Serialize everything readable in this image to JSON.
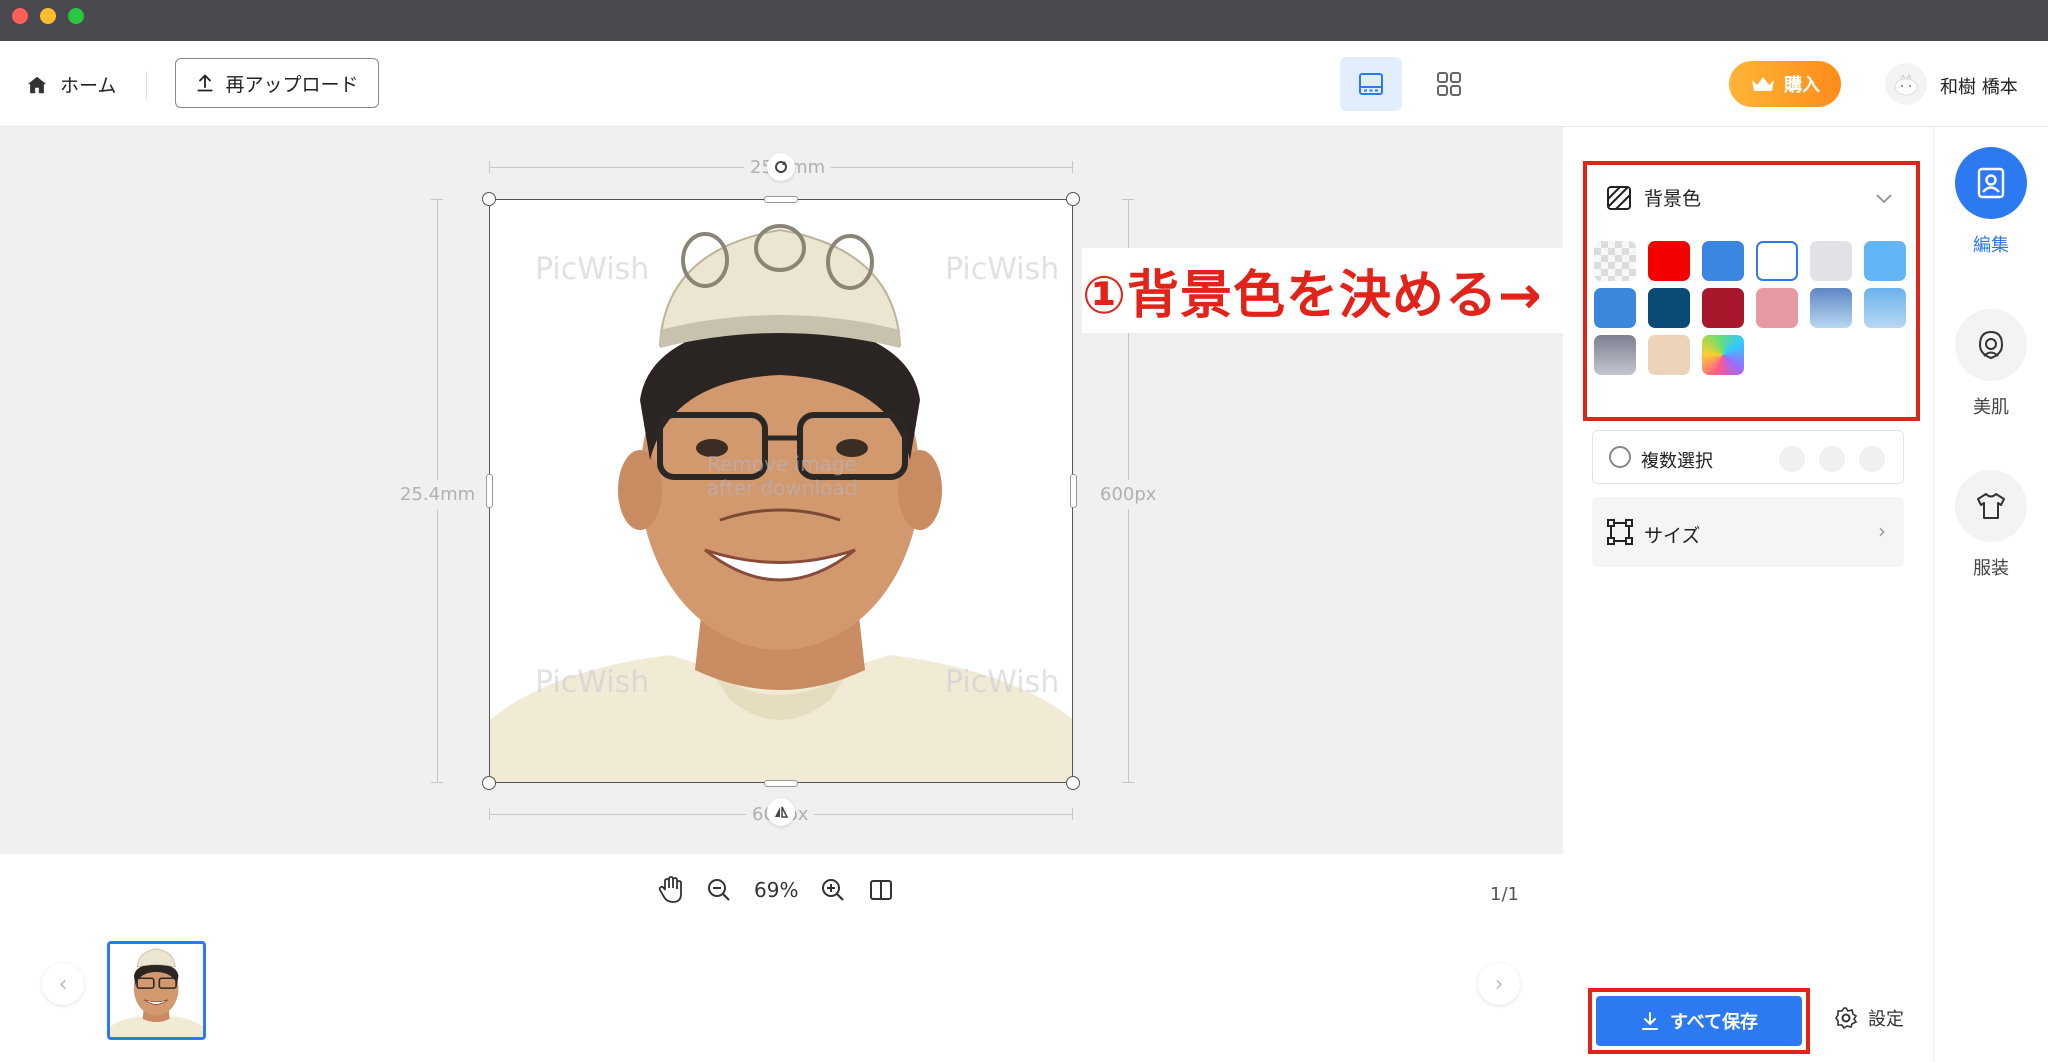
{
  "header": {
    "home_label": "ホーム",
    "reupload_label": "再アップロード",
    "buy_label": "購入",
    "username": "和樹 橋本"
  },
  "canvas": {
    "width_mm": "25.4mm",
    "height_mm": "25.4mm",
    "height_px": "600px",
    "width_px": "600px",
    "watermark": "PicWish",
    "center_watermark_1": "Remove image",
    "center_watermark_2": "after download"
  },
  "annotation": {
    "text": "①背景色を決める→"
  },
  "zoom": {
    "value": "69%"
  },
  "pager": "1/1",
  "panel": {
    "background_title": "背景色",
    "swatches": [
      {
        "name": "transparent",
        "color": "checker"
      },
      {
        "name": "red",
        "color": "#f50000"
      },
      {
        "name": "blue",
        "color": "#3a86e0"
      },
      {
        "name": "white",
        "color": "#ffffff"
      },
      {
        "name": "light-gray",
        "color": "#e2e1e6"
      },
      {
        "name": "sky-blue",
        "color": "#64b5f6"
      },
      {
        "name": "medium-blue",
        "color": "#3b87dd"
      },
      {
        "name": "navy",
        "color": "#0a4b75"
      },
      {
        "name": "dark-red",
        "color": "#a8172b"
      },
      {
        "name": "pink",
        "color": "#e89aa3"
      },
      {
        "name": "gradient-blue",
        "color": "#5d86c2"
      },
      {
        "name": "gradient-sky",
        "color": "#6ab3ee"
      },
      {
        "name": "gradient-gray",
        "color": "#8f93a0"
      },
      {
        "name": "beige",
        "color": "#ecd3b9"
      },
      {
        "name": "rainbow",
        "color": "rainbow"
      }
    ],
    "multi_select_label": "複数選択",
    "size_label": "サイズ",
    "save_all_label": "すべて保存",
    "settings_label": "設定"
  },
  "sidebar": {
    "items": [
      {
        "label": "編集",
        "icon": "portrait-icon",
        "active": true
      },
      {
        "label": "美肌",
        "icon": "face-icon",
        "active": false
      },
      {
        "label": "服装",
        "icon": "shirt-icon",
        "active": false
      }
    ]
  },
  "colors": {
    "accent": "#2d79f2",
    "annotation_red": "#e2231a",
    "buy_orange": "#ff9a22"
  }
}
